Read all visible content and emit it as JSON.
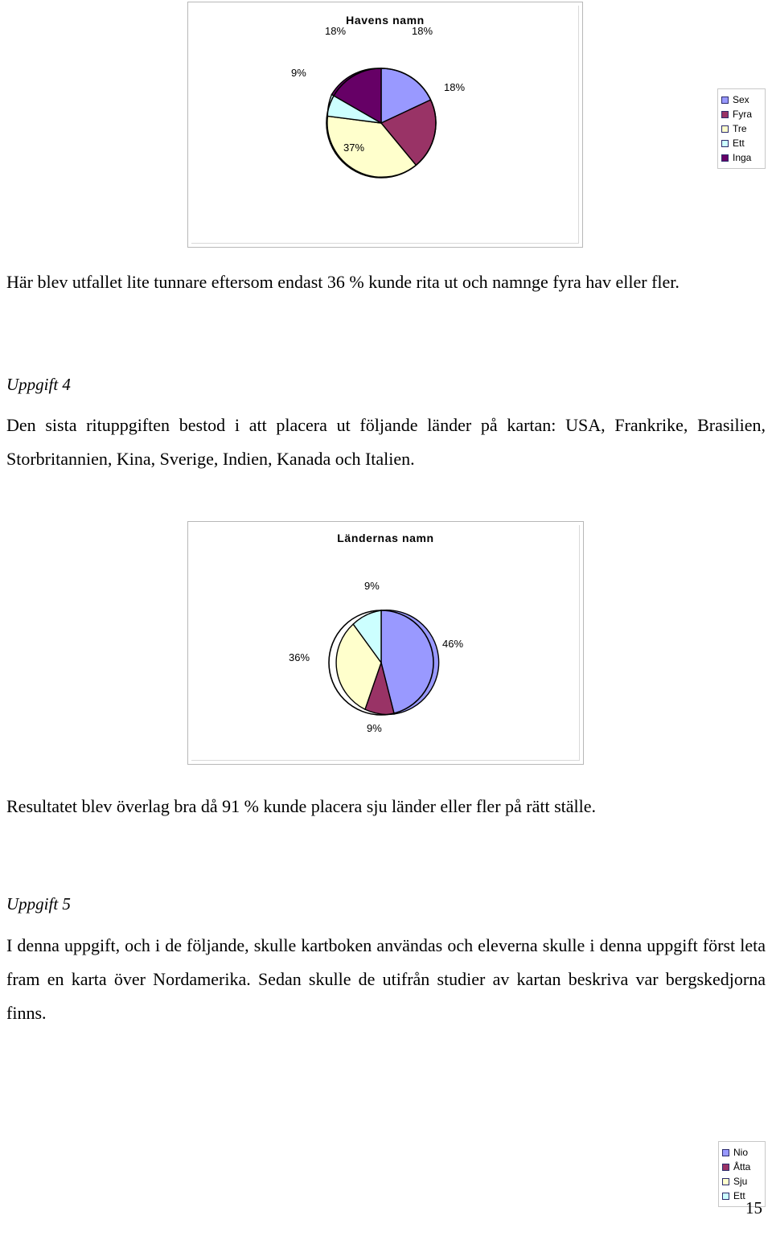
{
  "page": {
    "number": "15"
  },
  "charts": [
    {
      "id": "havens",
      "title": "Havens namn",
      "labels": [
        "18%",
        "18%",
        "37%",
        "9%",
        "18%"
      ],
      "legend": [
        {
          "label": "Sex",
          "color": "#9999ff"
        },
        {
          "label": "Fyra",
          "color": "#993366"
        },
        {
          "label": "Tre",
          "color": "#ffffcc"
        },
        {
          "label": "Ett",
          "color": "#ccffff"
        },
        {
          "label": "Inga",
          "color": "#660066"
        }
      ]
    },
    {
      "id": "landernas",
      "title": "Ländernas namn",
      "labels": [
        "46%",
        "9%",
        "36%",
        "9%"
      ],
      "legend": [
        {
          "label": "Nio",
          "color": "#9999ff"
        },
        {
          "label": "Åtta",
          "color": "#993366"
        },
        {
          "label": "Sju",
          "color": "#ffffcc"
        },
        {
          "label": "Ett",
          "color": "#ccffff"
        }
      ]
    }
  ],
  "chart_data": [
    {
      "type": "pie",
      "title": "Havens namn",
      "categories": [
        "Sex",
        "Fyra",
        "Tre",
        "Ett",
        "Inga"
      ],
      "values": [
        18,
        18,
        37,
        9,
        18
      ],
      "data_labels": [
        "18%",
        "18%",
        "37%",
        "9%",
        "18%"
      ],
      "colors": [
        "#9999ff",
        "#993366",
        "#ffffcc",
        "#ccffff",
        "#660066"
      ],
      "legend_position": "right",
      "grid": false,
      "xlabel": "",
      "ylabel": ""
    },
    {
      "type": "pie",
      "title": "Ländernas namn",
      "categories": [
        "Nio",
        "Åtta",
        "Sju",
        "Ett"
      ],
      "values": [
        46,
        9,
        36,
        9
      ],
      "data_labels": [
        "46%",
        "9%",
        "36%",
        "9%"
      ],
      "colors": [
        "#9999ff",
        "#993366",
        "#ffffcc",
        "#ccffff"
      ],
      "legend_position": "right",
      "grid": false,
      "xlabel": "",
      "ylabel": ""
    }
  ],
  "body": {
    "para_havens": "Här blev utfallet lite tunnare eftersom endast 36 % kunde rita ut och namnge fyra hav eller fler.",
    "heading_uppgift4": "Uppgift 4",
    "para_uppgift4": "Den sista rituppgiften bestod i att placera ut följande länder på kartan: USA, Frankrike, Brasilien, Storbritannien, Kina, Sverige, Indien, Kanada och Italien.",
    "para_resultat": "Resultatet blev överlag bra då 91 % kunde placera sju länder eller fler på rätt ställe.",
    "heading_uppgift5": "Uppgift 5",
    "para_uppgift5": "I denna uppgift, och i de följande, skulle kartboken användas och eleverna skulle i denna uppgift först leta fram en karta över Nordamerika. Sedan skulle de utifrån studier av kartan beskriva var bergskedjorna finns."
  }
}
